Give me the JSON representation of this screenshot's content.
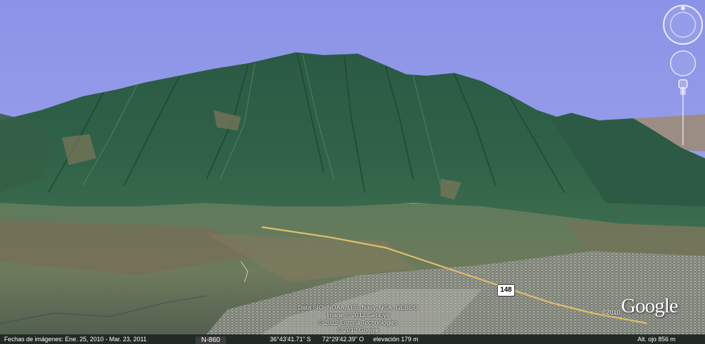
{
  "attribution": {
    "line1": "Data SIO, NOAA, U.S. Navy, NGA, GEBCO",
    "line2": "Image © 2012 GeoEye",
    "line3": "© 2012 Europa Technologies",
    "line4": "© 2012 Google"
  },
  "logo": {
    "text": "Google",
    "year": "©2010"
  },
  "route_shield": "148",
  "road_label": "N-860",
  "status": {
    "imagery_dates": "Fechas de imágenes: Ene. 25, 2010 - Mar. 23, 2011",
    "latitude": "36°43'41.71\" S",
    "longitude": "72°29'42.39\" O",
    "elevation": "elevación 179 m",
    "eye_altitude": "Alt. ojo    856 m"
  },
  "nav_icons": [
    "look-around-ring-icon",
    "move-joystick-icon",
    "zoom-slider-icon"
  ],
  "colors": {
    "sky": "#8c94e6",
    "forest": "#2f5e45",
    "valley": "#6b7a5a",
    "road": "#d9b86b"
  }
}
